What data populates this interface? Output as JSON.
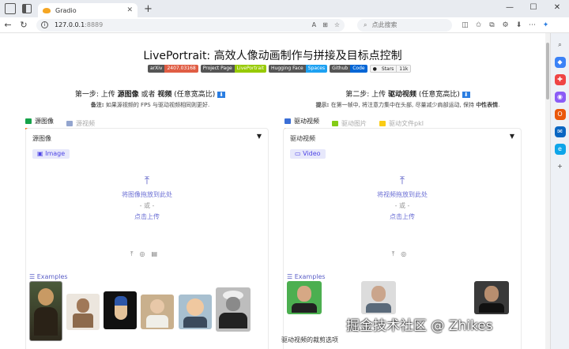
{
  "browser": {
    "tab_title": "Gradio",
    "url_host": "127.0.0.1",
    "url_port": ":8889",
    "search_placeholder": "点此搜索",
    "reader_label": "A"
  },
  "page": {
    "title": "LivePortrait: 高效人像动画制作与拼接及目标点控制",
    "badges": [
      {
        "l": "arXiv",
        "r": "2407.03168",
        "color": "#e05d44"
      },
      {
        "l": "Project Page",
        "r": "LivePortrait",
        "color": "#97ca00"
      },
      {
        "l": "Hugging Face",
        "r": "Spaces",
        "color": "#1da1f2"
      },
      {
        "l": "Github",
        "r": "Code",
        "color": "#0366d6"
      }
    ],
    "stars_label": "Stars",
    "stars_count": "11k",
    "step1": {
      "prefix": "第一步: 上传 ",
      "bold1": "源图像",
      "mid": " 或者 ",
      "bold2": "视频",
      "suffix": " (任意宽高比)",
      "note_bold": "备注:",
      "note": " 如果源视频的 FPS 与驱动视频相同则更好."
    },
    "step2": {
      "prefix": "第二步: 上传 ",
      "bold1": "驱动视频",
      "suffix": " (任意宽高比)",
      "note_bold": "提示:",
      "note": " 在第一帧中, 将注意力集中在头部, 尽量减少肩部运动, 保持 ",
      "note_bold2": "中性表情",
      "note_end": "."
    },
    "left_tabs": [
      "源图像",
      "源视频"
    ],
    "right_tabs": [
      "驱动视频",
      "驱动图片",
      "驱动文件pkl"
    ],
    "left_panel": {
      "header": "源图像",
      "chip": "Image",
      "drop_line1": "将图像拖放到此处",
      "drop_or": "- 或 -",
      "drop_line2": "点击上传",
      "examples_label": "Examples"
    },
    "right_panel": {
      "header": "驱动视频",
      "chip": "Video",
      "drop_line1": "将视频拖放到此处",
      "drop_or": "- 或 -",
      "drop_line2": "点击上传",
      "examples_label": "Examples"
    },
    "crop_label": "驱动视频的裁剪选项",
    "watermark": "掘金技术社区 @ Zhikes"
  }
}
